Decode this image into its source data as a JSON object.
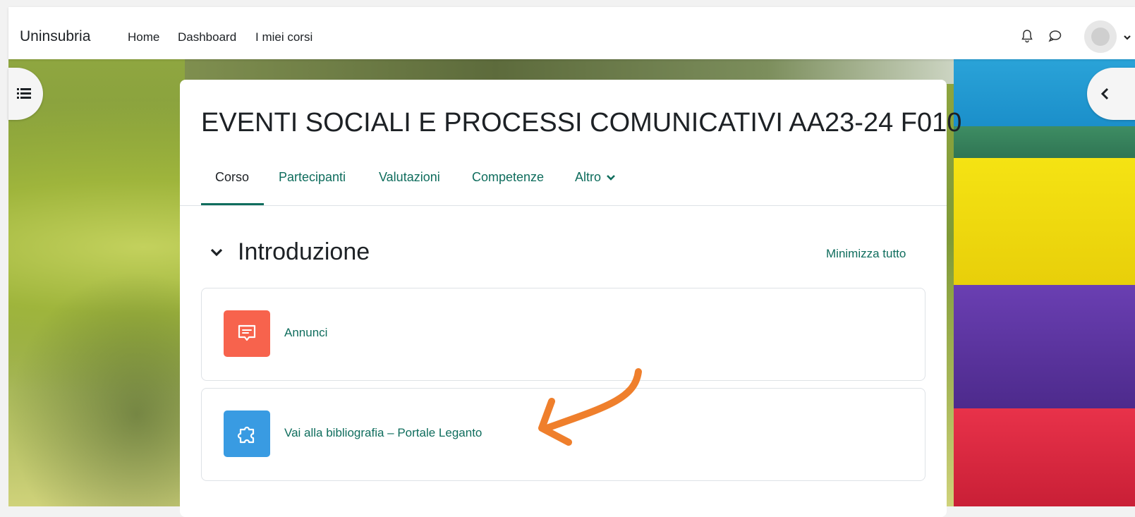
{
  "navbar": {
    "brand": "Uninsubria",
    "links": [
      "Home",
      "Dashboard",
      "I miei corsi"
    ]
  },
  "course": {
    "title": "EVENTI SOCIALI E PROCESSI COMUNICATIVI AA23-24 F010",
    "tabs": [
      "Corso",
      "Partecipanti",
      "Valutazioni",
      "Competenze",
      "Altro"
    ],
    "active_tab": "Corso"
  },
  "section": {
    "title": "Introduzione",
    "collapse_all": "Minimizza tutto",
    "activities": [
      {
        "label": "Annunci",
        "icon": "forum-icon",
        "color": "#f7634d"
      },
      {
        "label": "Vai alla bibliografia – Portale Leganto",
        "icon": "puzzle-icon",
        "color": "#399be2"
      }
    ]
  },
  "colors": {
    "link": "#0f6d5d",
    "annotation_arrow": "#ef7f2c"
  }
}
